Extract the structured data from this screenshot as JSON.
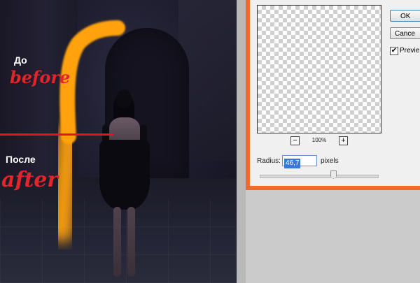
{
  "artwork": {
    "ru_before": "До",
    "en_before": "before",
    "ru_after": "После",
    "en_after": "after"
  },
  "dialog": {
    "ok_label": "OK",
    "cancel_label": "Cance",
    "preview_label": "Previe",
    "preview_checked": "✔",
    "zoom_out": "−",
    "zoom_in": "+",
    "zoom_level": "100%",
    "radius_label": "Radius:",
    "radius_value": "46,7",
    "radius_units": "pixels",
    "slider_fraction": 0.62
  },
  "colors": {
    "frame": "#f06a2e",
    "brush": "#ffa20a",
    "divider": "#e1161e",
    "label_red": "#e3242b"
  }
}
